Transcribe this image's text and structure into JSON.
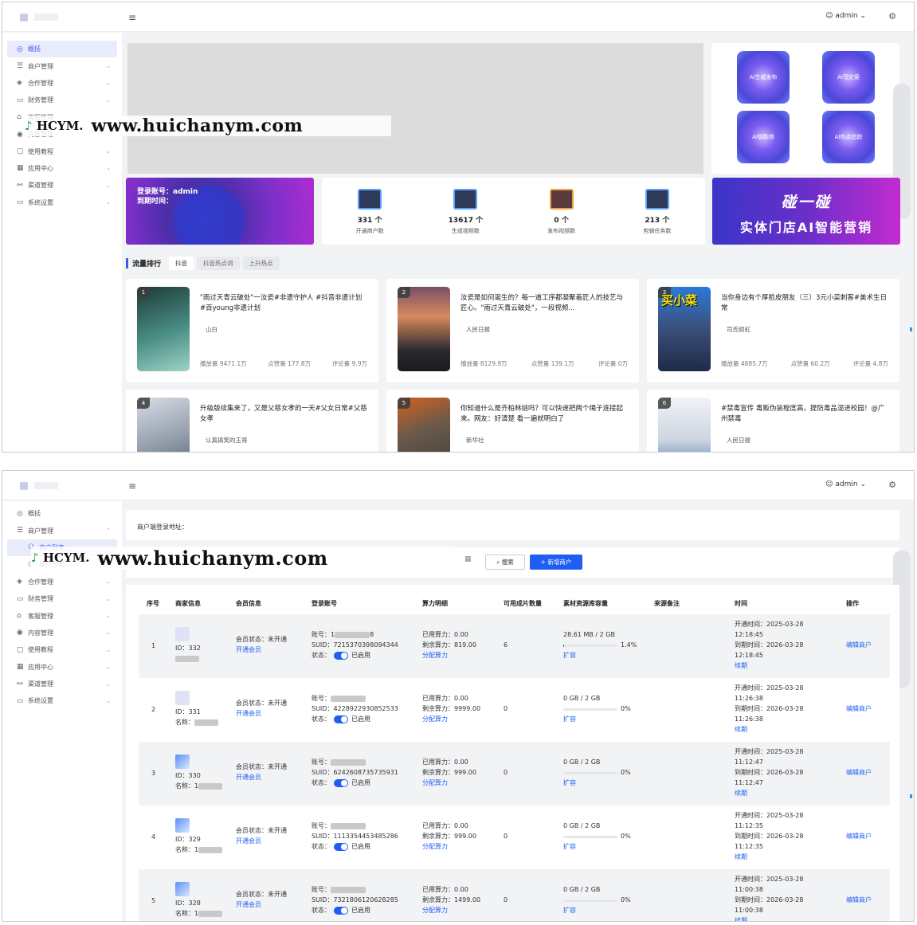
{
  "header": {
    "user_label": "admin",
    "caret": "⌄"
  },
  "sidebar1": {
    "items": [
      {
        "icon": "◎",
        "label": "概括",
        "active": true,
        "chevron": ""
      },
      {
        "icon": "☰",
        "label": "商户管理",
        "chevron": "⌄"
      },
      {
        "icon": "◈",
        "label": "合作管理",
        "chevron": "⌄"
      },
      {
        "icon": "▭",
        "label": "财务管理",
        "chevron": "⌄"
      },
      {
        "icon": "⌂",
        "label": "客服管理",
        "chevron": "⌄"
      },
      {
        "icon": "◉",
        "label": "内容管理",
        "chevron": "⌄"
      },
      {
        "icon": "▢",
        "label": "使用教程",
        "chevron": "⌄"
      },
      {
        "icon": "▦",
        "label": "应用中心",
        "chevron": "⌄"
      },
      {
        "icon": "⚯",
        "label": "渠道管理",
        "chevron": "⌄"
      },
      {
        "icon": "▭",
        "label": "系统设置",
        "chevron": "⌄"
      }
    ]
  },
  "watermark": {
    "brand_a": "HCYM",
    "brand_b": ".",
    "url": "www.huichanym.com"
  },
  "ai_tiles": [
    "AI生成发布",
    "AI写文案",
    "AI智能体",
    "AI热点追踪"
  ],
  "login": {
    "account": "登录账号：admin",
    "expire": "到期时间："
  },
  "stats": [
    {
      "value": "331",
      "unit": "个",
      "label": "开通商户数"
    },
    {
      "value": "13617",
      "unit": "个",
      "label": "生成视频数"
    },
    {
      "value": "0",
      "unit": "个",
      "label": "发布视频数"
    },
    {
      "value": "213",
      "unit": "个",
      "label": "剪辑任务数"
    }
  ],
  "promo": {
    "title": "碰一碰",
    "subtitle": "实体门店AI智能营销"
  },
  "ranking": {
    "title": "流量排行",
    "tabs": [
      "抖音",
      "抖音热点词",
      "上升热点"
    ]
  },
  "videos": [
    {
      "rank": "1",
      "title": "\"雨过天青云破处\"一汝瓷#非遗守护人 #抖音非遗计划 #百young非遗计划",
      "author": "山白",
      "plays": "播放量 9471.1万",
      "likes": "点赞量 177.8万",
      "comments": "评论量 9.9万"
    },
    {
      "rank": "2",
      "title": "汝瓷是如何诞生的？每一道工序都凝聚着匠人的技艺与匠心。\"雨过天青云破处\"，一段视频...",
      "author": "人民日报",
      "plays": "播放量 8129.9万",
      "likes": "点赞量 139.1万",
      "comments": "评论量 0万"
    },
    {
      "rank": "3",
      "title": "当你身边有个厚脸皮朋友（三）3元小菜刺客#美术生日常",
      "author": "司氏硕虹",
      "plays": "播放量 4885.7万",
      "likes": "点赞量 60.2万",
      "comments": "评论量 4.8万",
      "thumb_text": "买小菜"
    },
    {
      "rank": "4",
      "title": "升级版续集来了，又是父慈女孝的一天#父女日常#父慈女孝",
      "author": "认真搞笑的王哥"
    },
    {
      "rank": "5",
      "title": "你知道什么是齐柏林结吗？可以快速把两个绳子连接起来。网友：好清楚 看一遍就明白了",
      "author": "新华社"
    },
    {
      "rank": "6",
      "title": "#禁毒宣传 毒贩伪装程度高，提防毒品混进校园！@广州禁毒",
      "author": "人民日报"
    }
  ],
  "sidebar2": {
    "items": [
      {
        "icon": "◎",
        "label": "概括",
        "chevron": ""
      },
      {
        "icon": "☰",
        "label": "商户管理",
        "chevron": "⌃"
      },
      {
        "icon": "⚇",
        "label": "商户列表",
        "sub": true,
        "active": true
      },
      {
        "icon": "⚇",
        "label": "商户分类",
        "sub": true
      },
      {
        "icon": "◈",
        "label": "合作管理",
        "chevron": "⌄"
      },
      {
        "icon": "▭",
        "label": "财务管理",
        "chevron": "⌄"
      },
      {
        "icon": "⌂",
        "label": "客服管理",
        "chevron": "⌄"
      },
      {
        "icon": "◉",
        "label": "内容管理",
        "chevron": "⌄"
      },
      {
        "icon": "▢",
        "label": "使用教程",
        "chevron": "⌄"
      },
      {
        "icon": "▦",
        "label": "应用中心",
        "chevron": "⌄"
      },
      {
        "icon": "⚯",
        "label": "渠道管理",
        "chevron": "⌄"
      },
      {
        "icon": "▭",
        "label": "系统设置",
        "chevron": "⌄"
      }
    ]
  },
  "merchant_notice": "商户端登录地址：",
  "toolbar": {
    "search_label": "搜索",
    "add_label": "新增商户",
    "search_icon": "⌕",
    "add_icon": "+"
  },
  "table": {
    "headers": [
      "序号",
      "商家信息",
      "会员信息",
      "登录账号",
      "算力明细",
      "可用成片数量",
      "素材资源库容量",
      "来源备注",
      "时间",
      "操作"
    ],
    "rows": [
      {
        "idx": "1",
        "id": "ID：332",
        "name": "",
        "member": "会员状态：未开通",
        "open_member": "开通会员",
        "acct": "账号：1",
        "acct_tail": "8",
        "suid": "SUID：7215370398094344",
        "status": "状态：",
        "enabled": "已启用",
        "used": "已用算力：0.00",
        "left": "剩余算力：819.00",
        "alloc": "分配算力",
        "clips": "6",
        "cap": "28.61 MB / 2 GB",
        "pct": "1.4%",
        "pct_value": 1.4,
        "expand": "扩容",
        "open_time": "开通时间：2025-03-28",
        "open_clock": "12:18:45",
        "exp_time": "到期时间：2026-03-28",
        "exp_clock": "12:18:45",
        "renew": "续期",
        "edit": "编辑商户"
      },
      {
        "idx": "2",
        "id": "ID：331",
        "name": "名称：",
        "member": "会员状态：未开通",
        "open_member": "开通会员",
        "acct": "账号：",
        "acct_tail": "",
        "suid": "SUID：4228922930852533",
        "status": "状态：",
        "enabled": "已启用",
        "used": "已用算力：0.00",
        "left": "剩余算力：9999.00",
        "alloc": "分配算力",
        "clips": "0",
        "cap": "0 GB / 2 GB",
        "pct": "0%",
        "pct_value": 0,
        "expand": "扩容",
        "open_time": "开通时间：2025-03-28",
        "open_clock": "11:26:38",
        "exp_time": "到期时间：2026-03-28",
        "exp_clock": "11:26:38",
        "renew": "续期",
        "edit": "编辑商户"
      },
      {
        "idx": "3",
        "id": "ID：330",
        "name": "名称：1",
        "member": "会员状态：未开通",
        "open_member": "开通会员",
        "acct": "账号：",
        "acct_tail": "",
        "suid": "SUID：6242608735735931",
        "status": "状态：",
        "enabled": "已启用",
        "used": "已用算力：0.00",
        "left": "剩余算力：999.00",
        "alloc": "分配算力",
        "clips": "0",
        "cap": "0 GB / 2 GB",
        "pct": "0%",
        "pct_value": 0,
        "expand": "扩容",
        "open_time": "开通时间：2025-03-28",
        "open_clock": "11:12:47",
        "exp_time": "到期时间：2026-03-28",
        "exp_clock": "11:12:47",
        "renew": "续期",
        "edit": "编辑商户"
      },
      {
        "idx": "4",
        "id": "ID：329",
        "name": "名称：1",
        "member": "会员状态：未开通",
        "open_member": "开通会员",
        "acct": "账号：",
        "acct_tail": "",
        "suid": "SUID：1113354453485286",
        "status": "状态：",
        "enabled": "已启用",
        "used": "已用算力：0.00",
        "left": "剩余算力：999.00",
        "alloc": "分配算力",
        "clips": "0",
        "cap": "0 GB / 2 GB",
        "pct": "0%",
        "pct_value": 0,
        "expand": "扩容",
        "open_time": "开通时间：2025-03-28",
        "open_clock": "11:12:35",
        "exp_time": "到期时间：2026-03-28",
        "exp_clock": "11:12:35",
        "renew": "续期",
        "edit": "编辑商户"
      },
      {
        "idx": "5",
        "id": "ID：328",
        "name": "名称：1",
        "member": "会员状态：未开通",
        "open_member": "开通会员",
        "acct": "账号：",
        "acct_tail": "",
        "suid": "SUID：7321806120628285",
        "status": "状态：",
        "enabled": "已启用",
        "used": "已用算力：0.00",
        "left": "剩余算力：1499.00",
        "alloc": "分配算力",
        "clips": "0",
        "cap": "0 GB / 2 GB",
        "pct": "0%",
        "pct_value": 0,
        "expand": "扩容",
        "open_time": "开通时间：2025-03-28",
        "open_clock": "11:00:38",
        "exp_time": "到期时间：2026-03-28",
        "exp_clock": "11:00:38",
        "renew": "续期",
        "edit": "编辑商户"
      }
    ]
  }
}
